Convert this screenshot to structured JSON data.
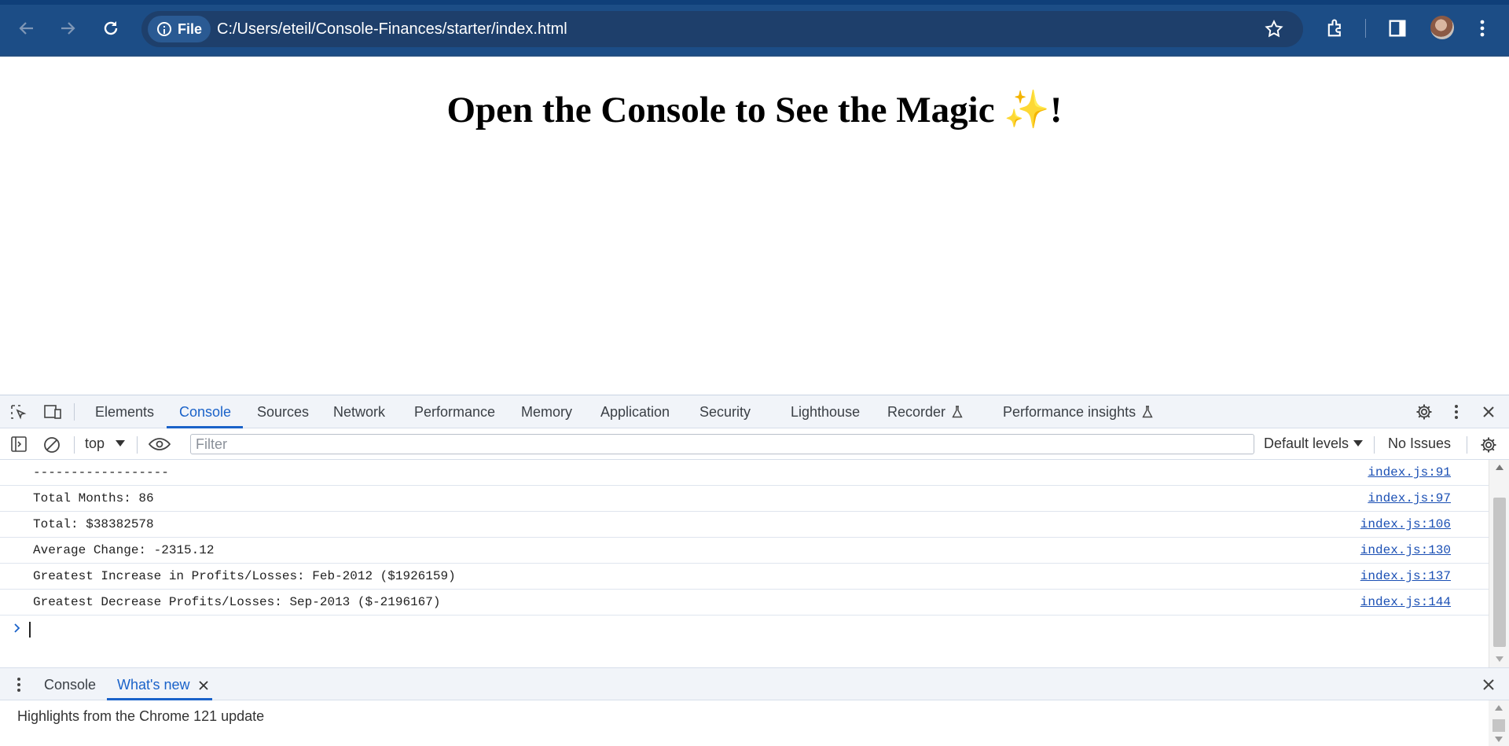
{
  "browser": {
    "site_chip_label": "File",
    "url": "C:/Users/eteil/Console-Finances/starter/index.html"
  },
  "page": {
    "title": "Open the Console to See the Magic ✨!"
  },
  "devtools": {
    "tabs": [
      {
        "label": "Elements"
      },
      {
        "label": "Console",
        "active": true
      },
      {
        "label": "Sources"
      },
      {
        "label": "Network"
      },
      {
        "label": "Performance"
      },
      {
        "label": "Memory"
      },
      {
        "label": "Application"
      },
      {
        "label": "Security"
      },
      {
        "label": "Lighthouse"
      },
      {
        "label": "Recorder"
      },
      {
        "label": "Performance insights"
      }
    ],
    "toolbar": {
      "context": "top",
      "filter_placeholder": "Filter",
      "levels": "Default levels",
      "issues": "No Issues"
    },
    "console_logs": [
      {
        "message": "------------------",
        "source": "index.js:91"
      },
      {
        "message": "Total Months: 86",
        "source": "index.js:97"
      },
      {
        "message": "Total: $38382578",
        "source": "index.js:106"
      },
      {
        "message": "Average Change: -2315.12",
        "source": "index.js:130"
      },
      {
        "message": "Greatest Increase in Profits/Losses: Feb-2012 ($1926159)",
        "source": "index.js:137"
      },
      {
        "message": "Greatest Decrease Profits/Losses: Sep-2013 ($-2196167)",
        "source": "index.js:144"
      }
    ],
    "drawer": {
      "tabs": [
        {
          "label": "Console"
        },
        {
          "label": "What's new",
          "active": true
        }
      ],
      "highlights": "Highlights from the Chrome 121 update"
    }
  },
  "colors": {
    "browser_bar": "#1c4d86",
    "accent_blue": "#1a62c9",
    "link": "#1a4fb4"
  }
}
